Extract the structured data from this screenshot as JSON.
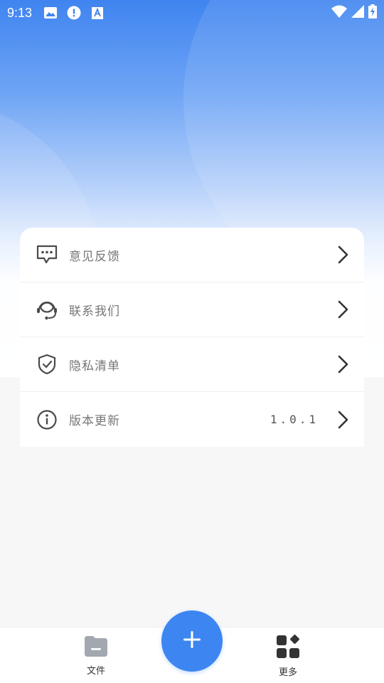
{
  "status_bar": {
    "time": "9:13",
    "icons": [
      "image-icon",
      "alert-icon",
      "keyboard-a-icon"
    ],
    "right_icons": [
      "wifi-icon",
      "signal-icon",
      "battery-charging-icon"
    ]
  },
  "menu": {
    "items": [
      {
        "label": "意见反馈",
        "icon": "feedback-chat-icon",
        "value": ""
      },
      {
        "label": "联系我们",
        "icon": "headset-icon",
        "value": ""
      },
      {
        "label": "隐私清单",
        "icon": "shield-check-icon",
        "value": ""
      },
      {
        "label": "版本更新",
        "icon": "info-icon",
        "value": "1.0.1"
      }
    ]
  },
  "tabbar": {
    "files_label": "文件",
    "more_label": "更多",
    "fab_icon": "plus-icon"
  },
  "colors": {
    "accent": "#3d86f2",
    "hero_top": "#3f84f0",
    "text_muted": "#777777"
  }
}
